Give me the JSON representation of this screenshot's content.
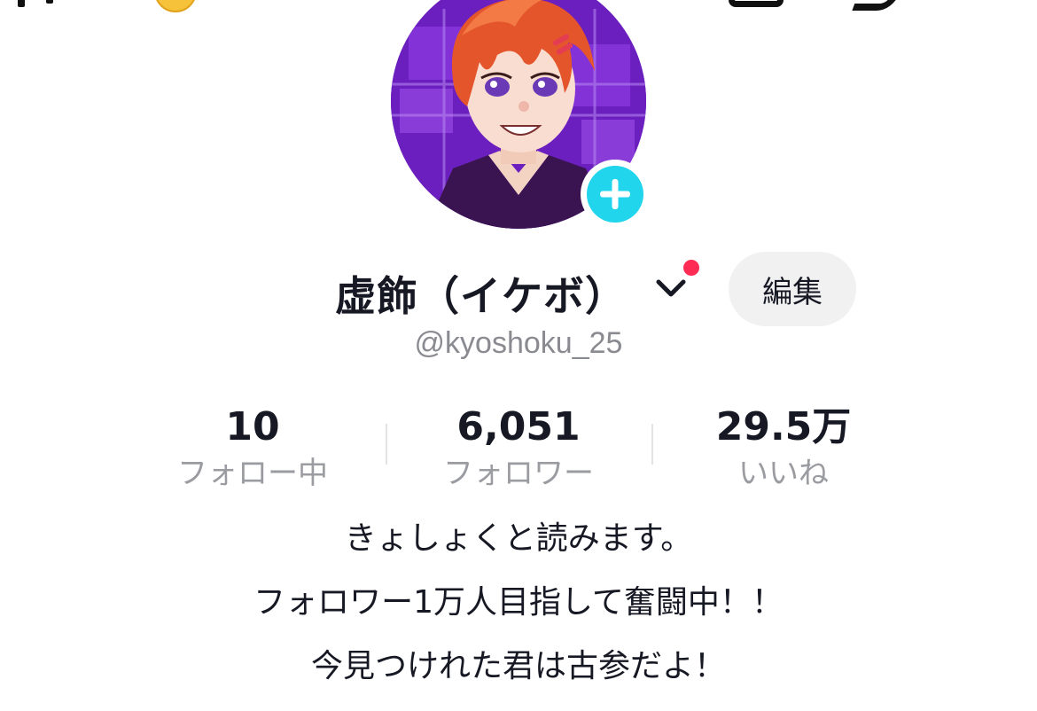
{
  "colors": {
    "accent_plus": "#20d5ec",
    "notification_dot": "#fe2c55",
    "edit_button_bg": "#f1f1f2",
    "muted_text": "#8a8b91"
  },
  "profile": {
    "display_name": "虚飾（イケボ）",
    "username": "@kyoshoku_25",
    "edit_label": "編集",
    "avatar_icon": "anime-avatar-image",
    "follow_icon": "plus-icon",
    "switch_account_icon": "chevron-down-icon"
  },
  "stats": {
    "following": {
      "value": "10",
      "label": "フォロー中"
    },
    "followers": {
      "value": "6,051",
      "label": "フォロワー"
    },
    "likes": {
      "value": "29.5万",
      "label": "いいね"
    }
  },
  "bio": {
    "lines": [
      "きょしょくと読みます。",
      "フォロワー1万人目指して奮闘中！！",
      "今見つけれた君は古参だよ！"
    ]
  }
}
